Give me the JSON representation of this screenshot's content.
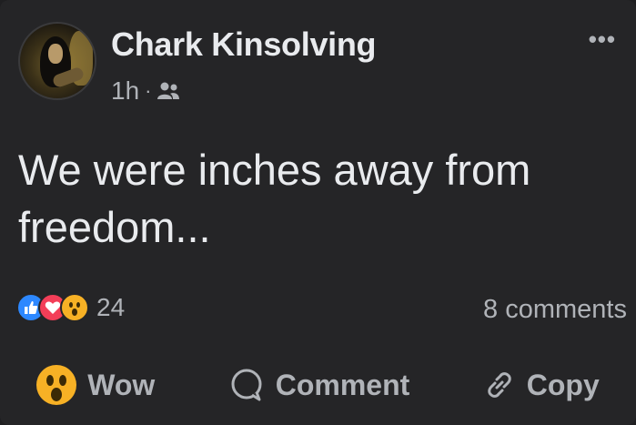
{
  "post": {
    "author": "Chark Kinsolving",
    "time": "1h",
    "separator": "·",
    "audience_icon": "friends-icon",
    "more_icon": "ellipsis-icon",
    "text_line1": "We were inches away from",
    "text_line2": "freedom..."
  },
  "reactions": {
    "icons": [
      "like-icon",
      "love-icon",
      "wow-icon"
    ],
    "count": "24",
    "comments": "8 comments"
  },
  "actions": {
    "wow_label": "Wow",
    "comment_label": "Comment",
    "copy_label": "Copy"
  },
  "colors": {
    "background": "#252527",
    "text": "#e9ebee",
    "secondary": "#b0b3b8",
    "like": "#2d88ff",
    "love": "#f33e58",
    "wow": "#f7b125"
  }
}
